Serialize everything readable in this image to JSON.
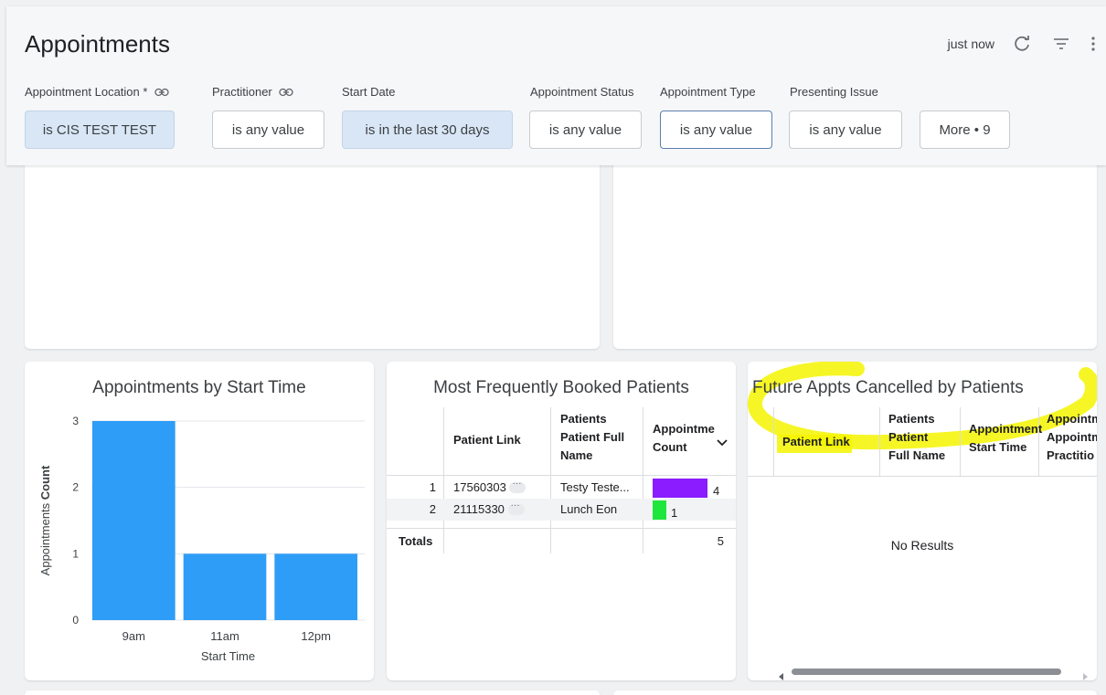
{
  "header": {
    "title": "Appointments",
    "updated": "just now",
    "icons": [
      "refresh-icon",
      "filter-icon",
      "more-vert-icon"
    ]
  },
  "filters": [
    {
      "label": "Appointment Location *",
      "value": "is CIS TEST TEST",
      "linked": true
    },
    {
      "label": "Practitioner",
      "value": "is any value",
      "linked": true
    },
    {
      "label": "Start Date",
      "value": "is in the last 30 days",
      "linked": false
    },
    {
      "label": "Appointment Status",
      "value": "is any value",
      "linked": false
    },
    {
      "label": "Appointment Type",
      "value": "is any value",
      "linked": false
    },
    {
      "label": "Presenting Issue",
      "value": "is any value",
      "linked": false
    }
  ],
  "more_filters": "More • 9",
  "start_time_chart": {
    "title": "Appointments by Start Time",
    "ylabel_prefix": "Appointments",
    "ylabel_bold": "Count",
    "xlabel": "Start Time",
    "y_ticks": [
      "0",
      "1",
      "2",
      "3"
    ]
  },
  "chart_data": {
    "type": "bar",
    "categories": [
      "9am",
      "11am",
      "12pm"
    ],
    "values": [
      3,
      1,
      1
    ],
    "title": "Appointments by Start Time",
    "xlabel": "Start Time",
    "ylabel": "Appointments Count",
    "ylim": [
      0,
      3
    ],
    "color": "#2e9df7"
  },
  "patients_table": {
    "title": "Most Frequently Booked Patients",
    "headers": {
      "link": "Patient Link",
      "name_1": "Patients",
      "name_2": "Patient Full",
      "name_3": "Name",
      "count_1": "Appointme",
      "count_2": "Count"
    },
    "rows": [
      {
        "num": "1",
        "link": "17560303",
        "name": "Testy Teste...",
        "count": "4",
        "bar_fraction": 1.0,
        "bar_color": "#8a1cff"
      },
      {
        "num": "2",
        "link": "21115330",
        "name": "Lunch Eon",
        "count": "1",
        "bar_fraction": 0.25,
        "bar_color": "#1ee63c"
      }
    ],
    "totals_label": "Totals",
    "totals_count": "5"
  },
  "cancelled_table": {
    "title": "Future Appts Cancelled by Patients",
    "headers": {
      "link": "Patient Link",
      "name_1": "Patients",
      "name_2": "Patient",
      "name_3": "Full Name",
      "start_1": "Appointment",
      "start_2": "Start Time",
      "prac_1": "Appointm",
      "prac_2": "Appointm",
      "prac_3": "Practitio"
    },
    "empty": "No Results",
    "highlight_color": "#f5f500"
  }
}
